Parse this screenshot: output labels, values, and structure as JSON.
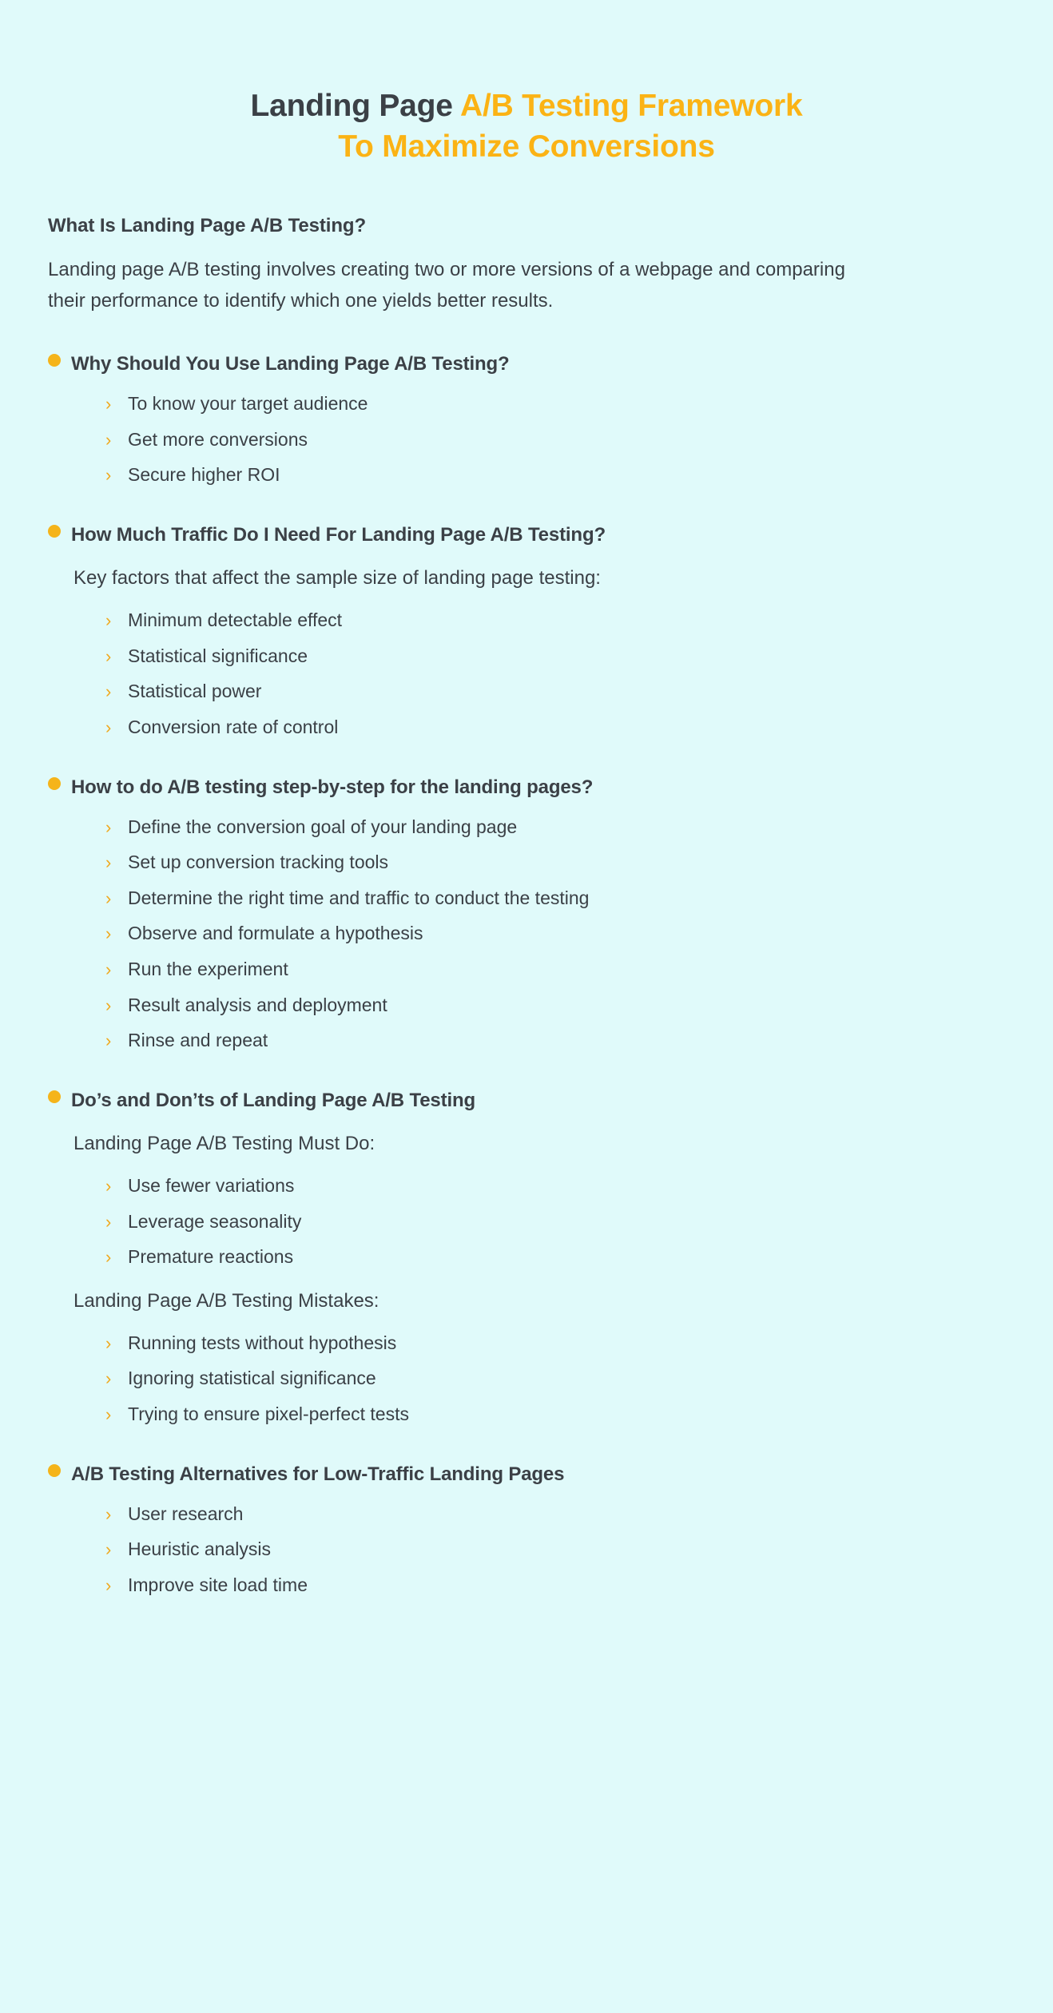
{
  "colors": {
    "background": "#e0fafa",
    "accent": "#fbb315",
    "bullet": "#f5b41a",
    "chevron": "#f0a81c",
    "text_dark": "#3b4046"
  },
  "title": {
    "line1_dark": "Landing Page ",
    "line1_accent": "A/B Testing Framework",
    "line2_accent": "To Maximize Conversions"
  },
  "intro": {
    "heading": "What Is Landing Page A/B Testing?",
    "paragraph": "Landing page A/B testing involves creating two or more versions of a webpage and comparing their performance to identify which one yields better results."
  },
  "icons": {
    "bullet": "bullet-dot-icon",
    "chevron": "chevron-right-icon"
  },
  "sections": [
    {
      "title": "Why Should You Use Landing Page A/B Testing?",
      "note": null,
      "items": [
        "To know your target audience",
        "Get more conversions",
        "Secure higher ROI"
      ]
    },
    {
      "title": "How Much Traffic Do I Need For Landing Page A/B Testing?",
      "note": "Key factors that affect the sample size of landing page testing:",
      "items": [
        "Minimum detectable effect",
        "Statistical significance",
        "Statistical power",
        "Conversion rate of control"
      ]
    },
    {
      "title": "How to do A/B testing step-by-step for the landing pages?",
      "note": null,
      "items": [
        "Define the conversion goal of your landing page",
        "Set up conversion tracking tools",
        "Determine the right time and traffic to conduct the testing",
        "Observe and formulate a hypothesis",
        "Run the experiment",
        "Result analysis and deployment",
        "Rinse and repeat"
      ]
    },
    {
      "title": "Do’s and Don’ts of Landing Page A/B Testing",
      "note": "Landing Page A/B Testing Must Do:",
      "items": [
        "Use fewer variations",
        "Leverage seasonality",
        "Premature reactions"
      ],
      "note2": "Landing Page A/B Testing Mistakes:",
      "items2": [
        "Running tests without hypothesis",
        "Ignoring statistical significance",
        "Trying to ensure pixel-perfect tests"
      ]
    },
    {
      "title": "A/B Testing Alternatives for Low-Traffic Landing Pages",
      "note": null,
      "items": [
        "User research",
        "Heuristic analysis",
        "Improve site load time"
      ]
    }
  ]
}
